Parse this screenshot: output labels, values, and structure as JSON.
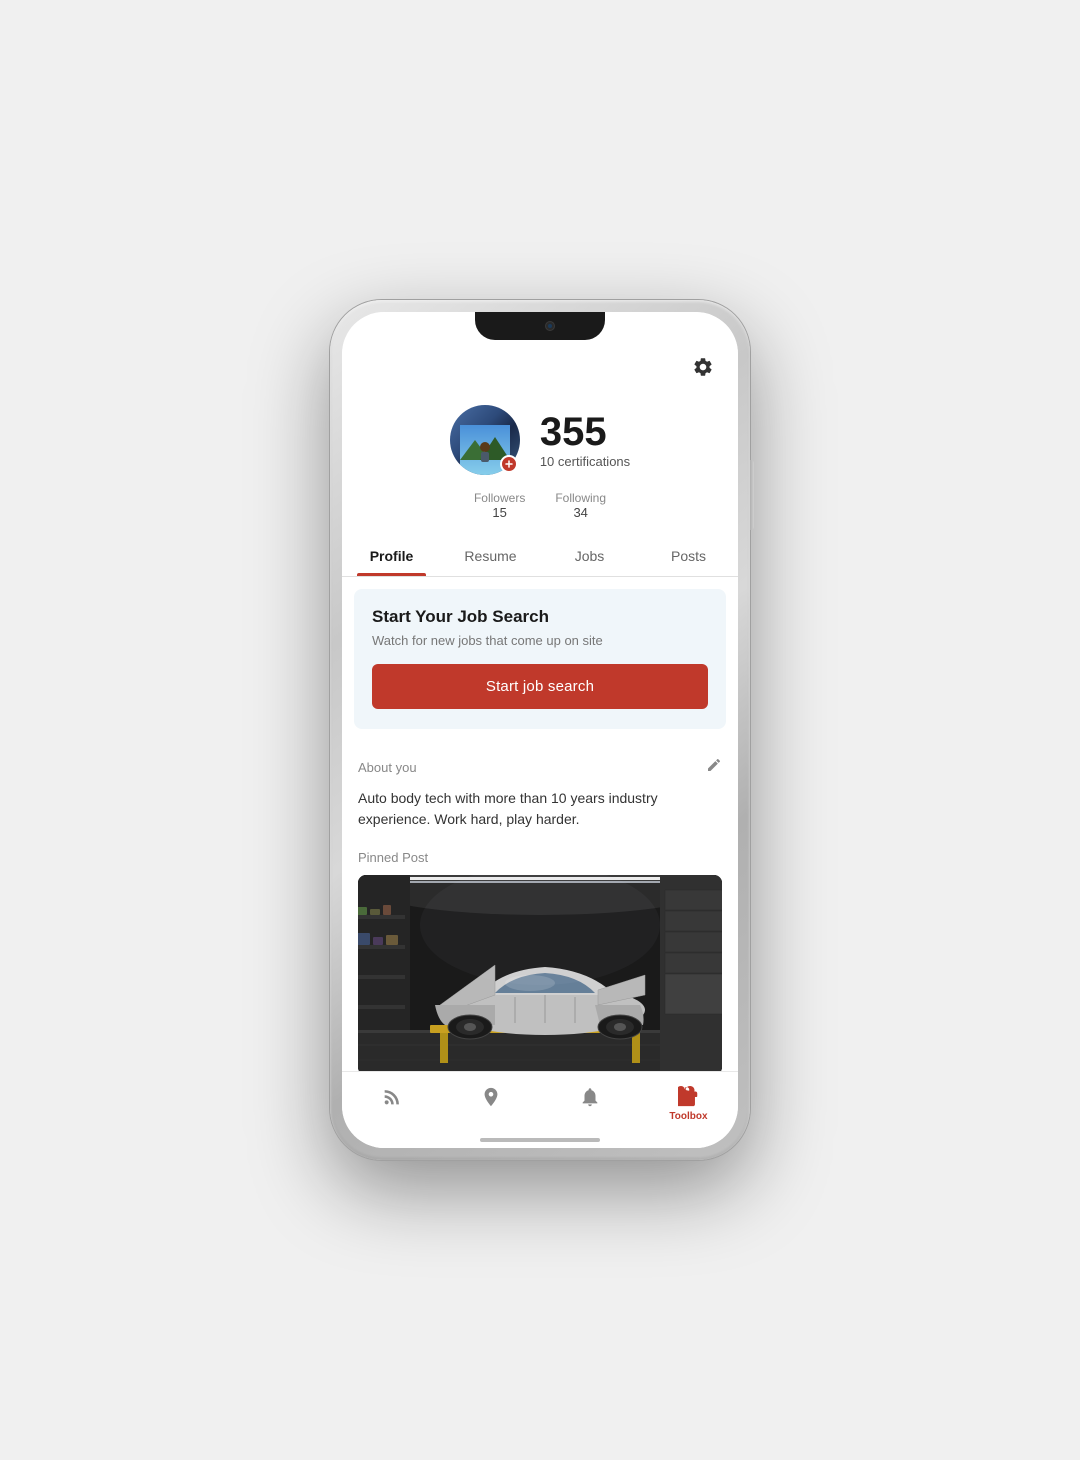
{
  "phone": {
    "settings_icon": "⚙",
    "profile": {
      "score": "355",
      "certifications": "10 certifications",
      "followers_label": "Followers",
      "followers_count": "15",
      "following_label": "Following",
      "following_count": "34"
    },
    "tabs": [
      {
        "id": "profile",
        "label": "Profile",
        "active": true
      },
      {
        "id": "resume",
        "label": "Resume",
        "active": false
      },
      {
        "id": "jobs",
        "label": "Jobs",
        "active": false
      },
      {
        "id": "posts",
        "label": "Posts",
        "active": false
      }
    ],
    "job_search_card": {
      "title": "Start Your Job Search",
      "subtitle": "Watch for new jobs that come up on site",
      "button_label": "Start job search"
    },
    "about": {
      "title": "About you",
      "text": "Auto body tech with more than 10 years industry experience. Work hard, play harder.",
      "edit_icon": "✏"
    },
    "pinned_post": {
      "title": "Pinned Post"
    },
    "bottom_nav": [
      {
        "id": "feed",
        "icon": "feed",
        "label": "",
        "active": false
      },
      {
        "id": "explore",
        "icon": "explore",
        "label": "",
        "active": false
      },
      {
        "id": "notifications",
        "icon": "notifications",
        "label": "",
        "active": false
      },
      {
        "id": "toolbox",
        "icon": "toolbox",
        "label": "Toolbox",
        "active": true
      }
    ]
  }
}
